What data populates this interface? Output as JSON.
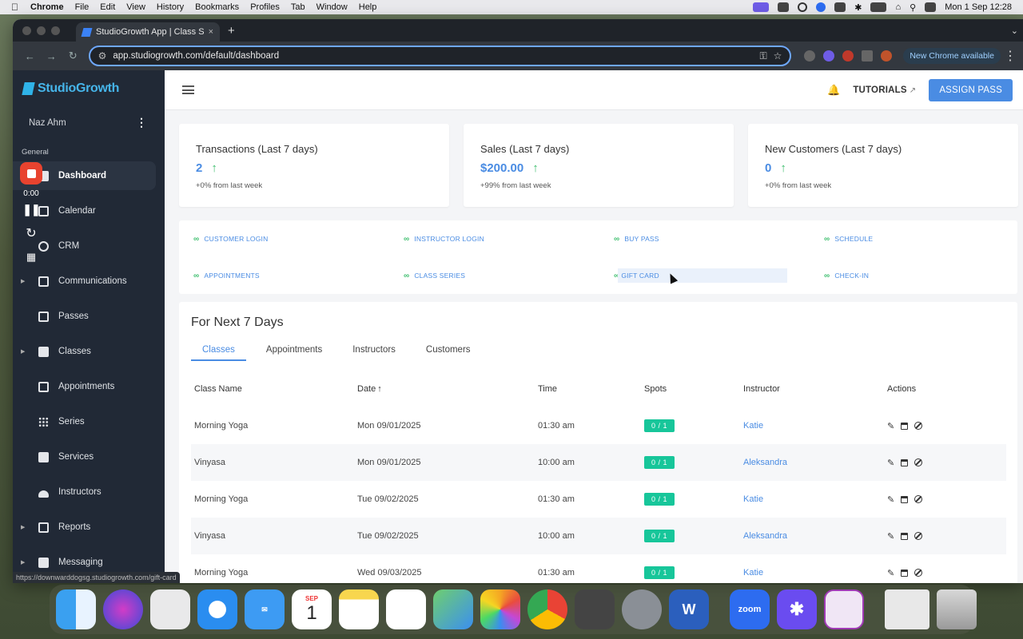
{
  "menubar": {
    "app_name": "Chrome",
    "items": [
      "File",
      "Edit",
      "View",
      "History",
      "Bookmarks",
      "Profiles",
      "Tab",
      "Window",
      "Help"
    ],
    "datetime": "Mon 1 Sep  12:28"
  },
  "browser": {
    "tab_title": "StudioGrowth App | Class Sc",
    "url": "app.studiogrowth.com/default/dashboard",
    "new_chrome_label": "New Chrome available",
    "status_url": "https://downwarddogsg.studiogrowth.com/gift-card"
  },
  "sidebar": {
    "logo_text": "StudioGrowth",
    "user_name": "Naz Ahm",
    "section_label": "General",
    "items": [
      {
        "label": "Dashboard",
        "icon": "dashboard-icon"
      },
      {
        "label": "Calendar",
        "icon": "calendar-icon"
      },
      {
        "label": "CRM",
        "icon": "crm-icon"
      },
      {
        "label": "Communications",
        "icon": "communications-icon"
      },
      {
        "label": "Passes",
        "icon": "passes-icon"
      },
      {
        "label": "Classes",
        "icon": "classes-icon"
      },
      {
        "label": "Appointments",
        "icon": "appointments-icon"
      },
      {
        "label": "Series",
        "icon": "series-icon"
      },
      {
        "label": "Services",
        "icon": "services-icon"
      },
      {
        "label": "Instructors",
        "icon": "instructors-icon"
      },
      {
        "label": "Reports",
        "icon": "reports-icon"
      },
      {
        "label": "Messaging",
        "icon": "messaging-icon"
      }
    ]
  },
  "recorder": {
    "time": "0:00"
  },
  "header": {
    "tutorials_label": "TUTORIALS",
    "assign_label": "ASSIGN PASS"
  },
  "stats": [
    {
      "label": "Transactions (Last 7 days)",
      "value": "2",
      "sub": "+0% from last week"
    },
    {
      "label": "Sales (Last 7 days)",
      "value": "$200.00",
      "sub": "+99% from last week"
    },
    {
      "label": "New Customers (Last 7 days)",
      "value": "0",
      "sub": "+0% from last week"
    }
  ],
  "quick_links": [
    "CUSTOMER LOGIN",
    "INSTRUCTOR LOGIN",
    "BUY PASS",
    "SCHEDULE",
    "APPOINTMENTS",
    "CLASS SERIES",
    "GIFT CARD",
    "CHECK-IN"
  ],
  "upcoming": {
    "title": "For Next 7 Days",
    "tabs": [
      "Classes",
      "Appointments",
      "Instructors",
      "Customers"
    ],
    "columns": [
      "Class Name",
      "Date",
      "Time",
      "Spots",
      "Instructor",
      "Actions"
    ],
    "rows": [
      {
        "name": "Morning Yoga",
        "date": "Mon 09/01/2025",
        "time": "01:30 am",
        "spots": "0 / 1",
        "instructor": "Katie"
      },
      {
        "name": "Vinyasa",
        "date": "Mon 09/01/2025",
        "time": "10:00 am",
        "spots": "0 / 1",
        "instructor": "Aleksandra"
      },
      {
        "name": "Morning Yoga",
        "date": "Tue 09/02/2025",
        "time": "01:30 am",
        "spots": "0 / 1",
        "instructor": "Katie"
      },
      {
        "name": "Vinyasa",
        "date": "Tue 09/02/2025",
        "time": "10:00 am",
        "spots": "0 / 1",
        "instructor": "Aleksandra"
      },
      {
        "name": "Morning Yoga",
        "date": "Wed 09/03/2025",
        "time": "01:30 am",
        "spots": "0 / 1",
        "instructor": "Katie"
      }
    ]
  },
  "dock": {
    "calendar_month": "SEP",
    "calendar_day": "1",
    "zoom_label": "zoom"
  }
}
